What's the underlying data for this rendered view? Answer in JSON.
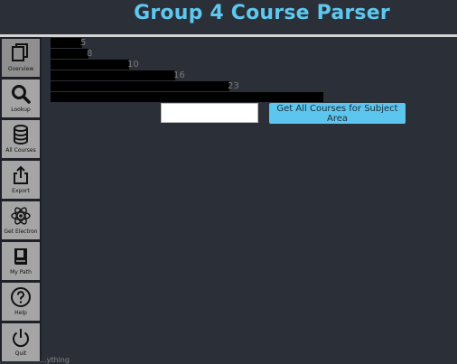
{
  "app": {
    "title": "Group 4 Course Parser"
  },
  "sidebar": {
    "items": [
      {
        "label": "Overview",
        "icon": "copy-icon"
      },
      {
        "label": "Lookup",
        "icon": "search-icon"
      },
      {
        "label": "All Courses",
        "icon": "database-icon"
      },
      {
        "label": "Export",
        "icon": "share-icon"
      },
      {
        "label": "Get Electron",
        "icon": "atom-icon"
      },
      {
        "label": "My Path",
        "icon": "book-icon"
      },
      {
        "label": "Help",
        "icon": "help-icon"
      },
      {
        "label": "Quit",
        "icon": "power-icon"
      }
    ]
  },
  "main": {
    "redacted_lines": [
      {
        "tail": "5"
      },
      {
        "tail": "8"
      },
      {
        "tail": "10"
      },
      {
        "tail": "16"
      },
      {
        "tail": "23"
      },
      {
        "tail": ""
      }
    ],
    "subject_input": {
      "value": "",
      "placeholder": ""
    },
    "get_courses_button": "Get All Courses for Subject Area"
  },
  "footer": {
    "text": "...ything"
  },
  "colors": {
    "accent": "#5ec8ef",
    "background": "#2b2f37",
    "sidebar": "#1d2127",
    "nav_button": "#a5a5a5"
  }
}
